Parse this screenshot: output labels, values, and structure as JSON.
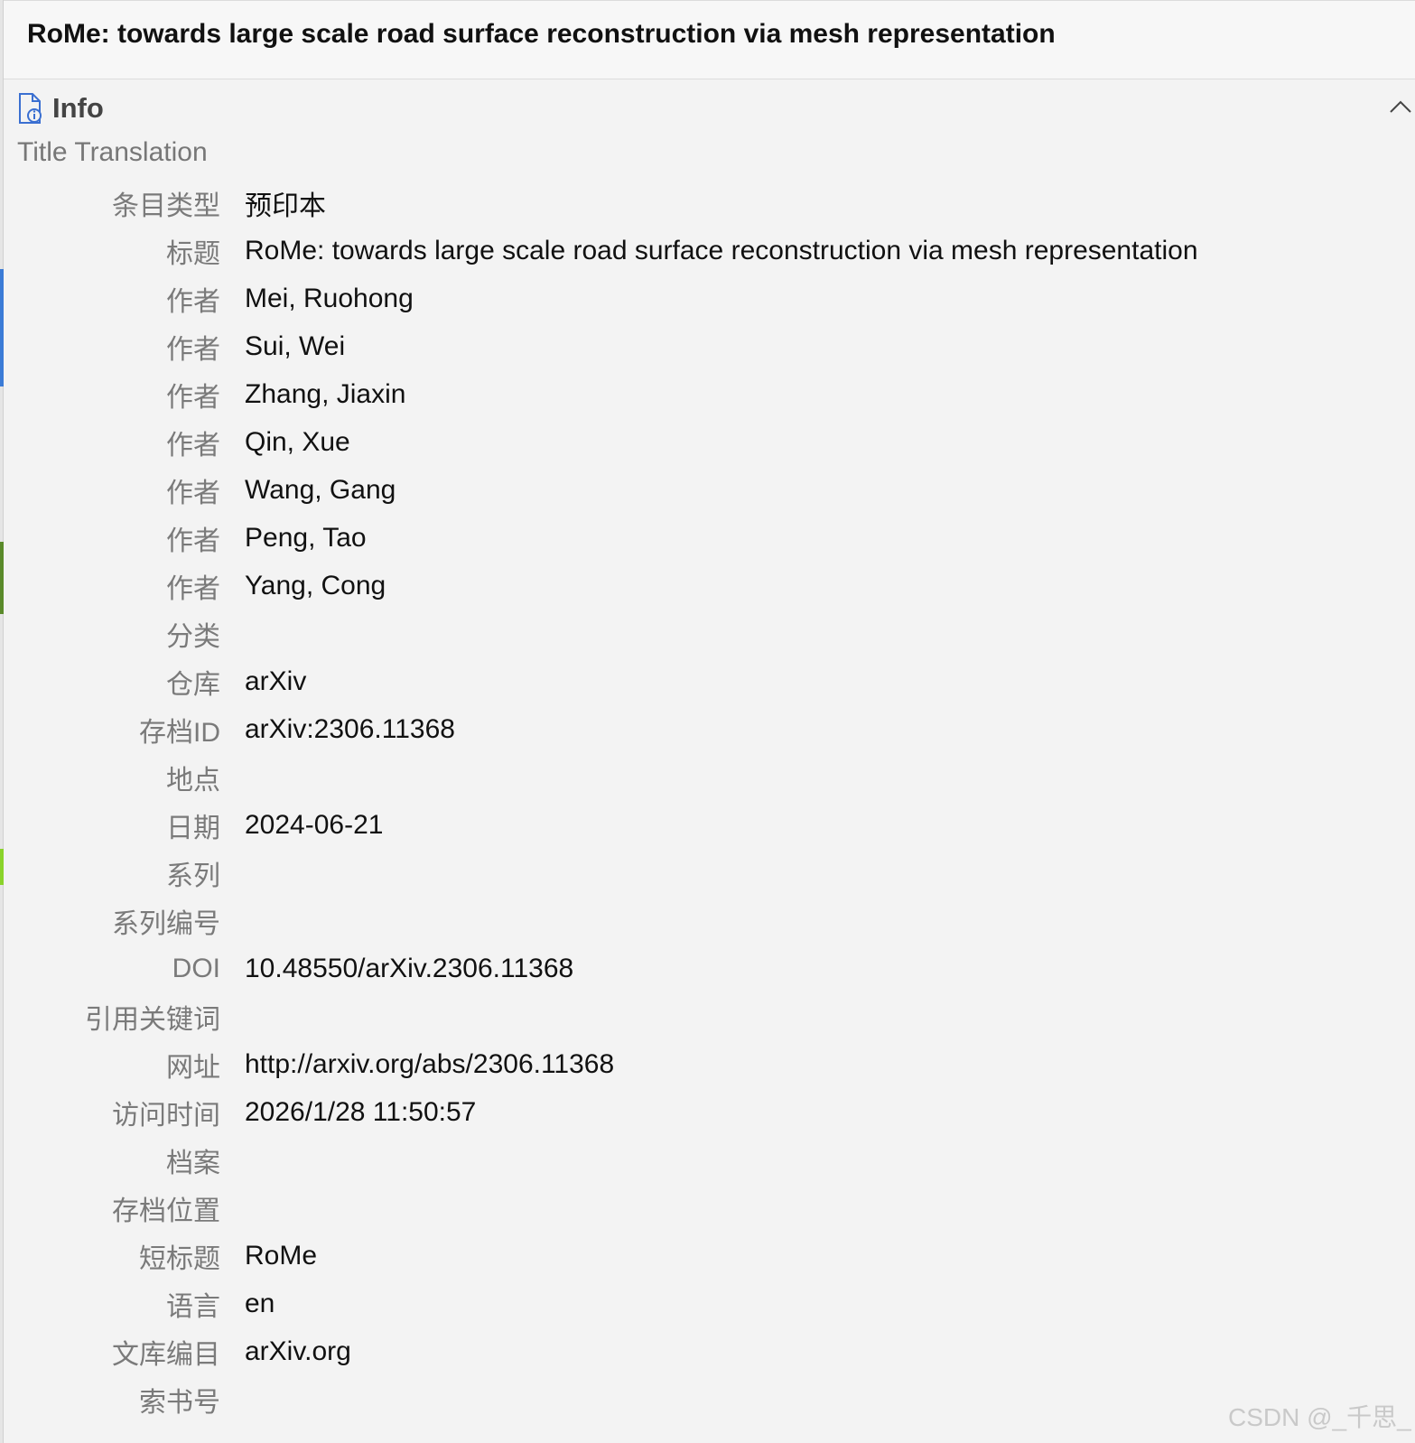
{
  "window": {
    "title": "RoMe: towards large scale road surface reconstruction via mesh representation"
  },
  "info": {
    "section_title": "Info",
    "subtitle": "Title Translation",
    "icon": "document-info-icon",
    "collapse_icon": "chevron-up-icon",
    "fields": [
      {
        "label": "条目类型",
        "value": "预印本"
      },
      {
        "label": "标题",
        "value": "RoMe: towards large scale road surface reconstruction via mesh representation"
      },
      {
        "label": "作者",
        "value": "Mei, Ruohong"
      },
      {
        "label": "作者",
        "value": "Sui, Wei"
      },
      {
        "label": "作者",
        "value": "Zhang, Jiaxin"
      },
      {
        "label": "作者",
        "value": "Qin, Xue"
      },
      {
        "label": "作者",
        "value": "Wang, Gang"
      },
      {
        "label": "作者",
        "value": "Peng, Tao"
      },
      {
        "label": "作者",
        "value": "Yang, Cong"
      },
      {
        "label": "分类",
        "value": ""
      },
      {
        "label": "仓库",
        "value": "arXiv"
      },
      {
        "label": "存档ID",
        "value": "arXiv:2306.11368"
      },
      {
        "label": "地点",
        "value": ""
      },
      {
        "label": "日期",
        "value": "2024-06-21"
      },
      {
        "label": "系列",
        "value": ""
      },
      {
        "label": "系列编号",
        "value": ""
      },
      {
        "label": "DOI",
        "value": "10.48550/arXiv.2306.11368"
      },
      {
        "label": "引用关键词",
        "value": ""
      },
      {
        "label": "网址",
        "value": "http://arxiv.org/abs/2306.11368"
      },
      {
        "label": "访问时间",
        "value": "2026/1/28 11:50:57"
      },
      {
        "label": "档案",
        "value": ""
      },
      {
        "label": "存档位置",
        "value": ""
      },
      {
        "label": "短标题",
        "value": "RoMe"
      },
      {
        "label": "语言",
        "value": "en"
      },
      {
        "label": "文库编目",
        "value": "arXiv.org"
      },
      {
        "label": "索书号",
        "value": ""
      }
    ]
  },
  "watermark": "CSDN @_千思_"
}
